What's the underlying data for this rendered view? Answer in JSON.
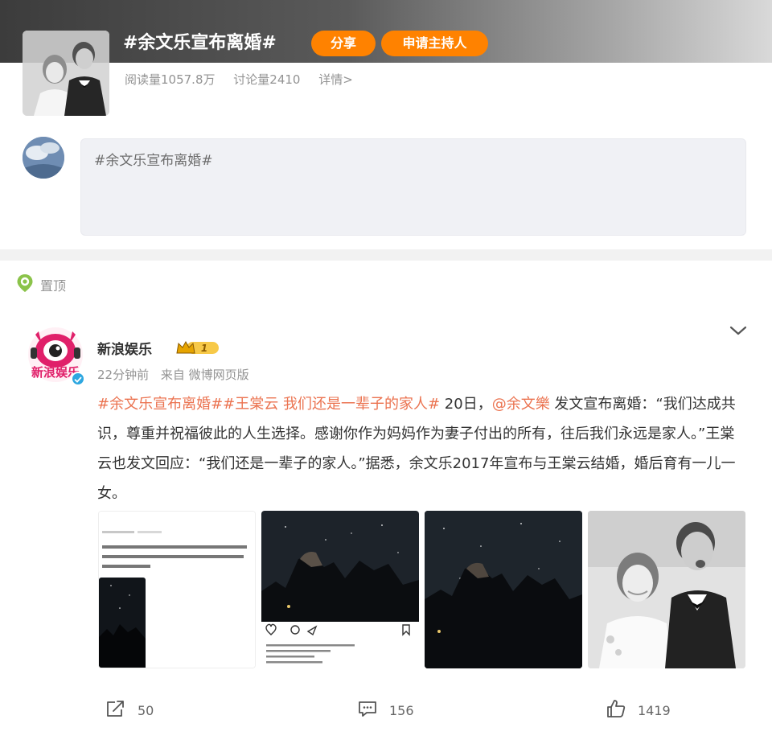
{
  "topic": {
    "title": "#余文乐宣布离婚#",
    "share_label": "分享",
    "host_label": "申请主持人",
    "reads": "阅读量1057.8万",
    "discussions": "讨论量2410",
    "detail_label": "详情>"
  },
  "composer": {
    "value": "#余文乐宣布离婚#"
  },
  "post": {
    "pinned_label": "置顶",
    "author": "新浪娱乐",
    "vip_level": "1",
    "time": "22分钟前",
    "source": "来自 微博网页版",
    "text": {
      "tag1": "#余文乐宣布离婚#",
      "tag2": "#王棠云 我们还是一辈子的家人#",
      "part1": " 20日，",
      "mention": "@余文樂",
      "part2": " 发文宣布离婚：“我们达成共识，尊重并祝福彼此的人生选择。感谢你作为妈妈作为妻子付出的所有，往后我们永远是家人。”王棠云也发文回应：“我们还是一辈子的家人。”据悉，余文乐2017年宣布与王棠云结婚，婚后育有一儿一女。"
    },
    "actions": {
      "reposts": "50",
      "comments": "156",
      "likes": "1419"
    }
  },
  "colors": {
    "accent_orange": "#ff8200",
    "link_orange": "#eb7350",
    "muted_text": "#939393"
  },
  "icons": [
    "pin-icon",
    "chevron-down-icon",
    "share-icon",
    "comment-icon",
    "like-icon",
    "verified-icon",
    "vip-crown-icon"
  ]
}
